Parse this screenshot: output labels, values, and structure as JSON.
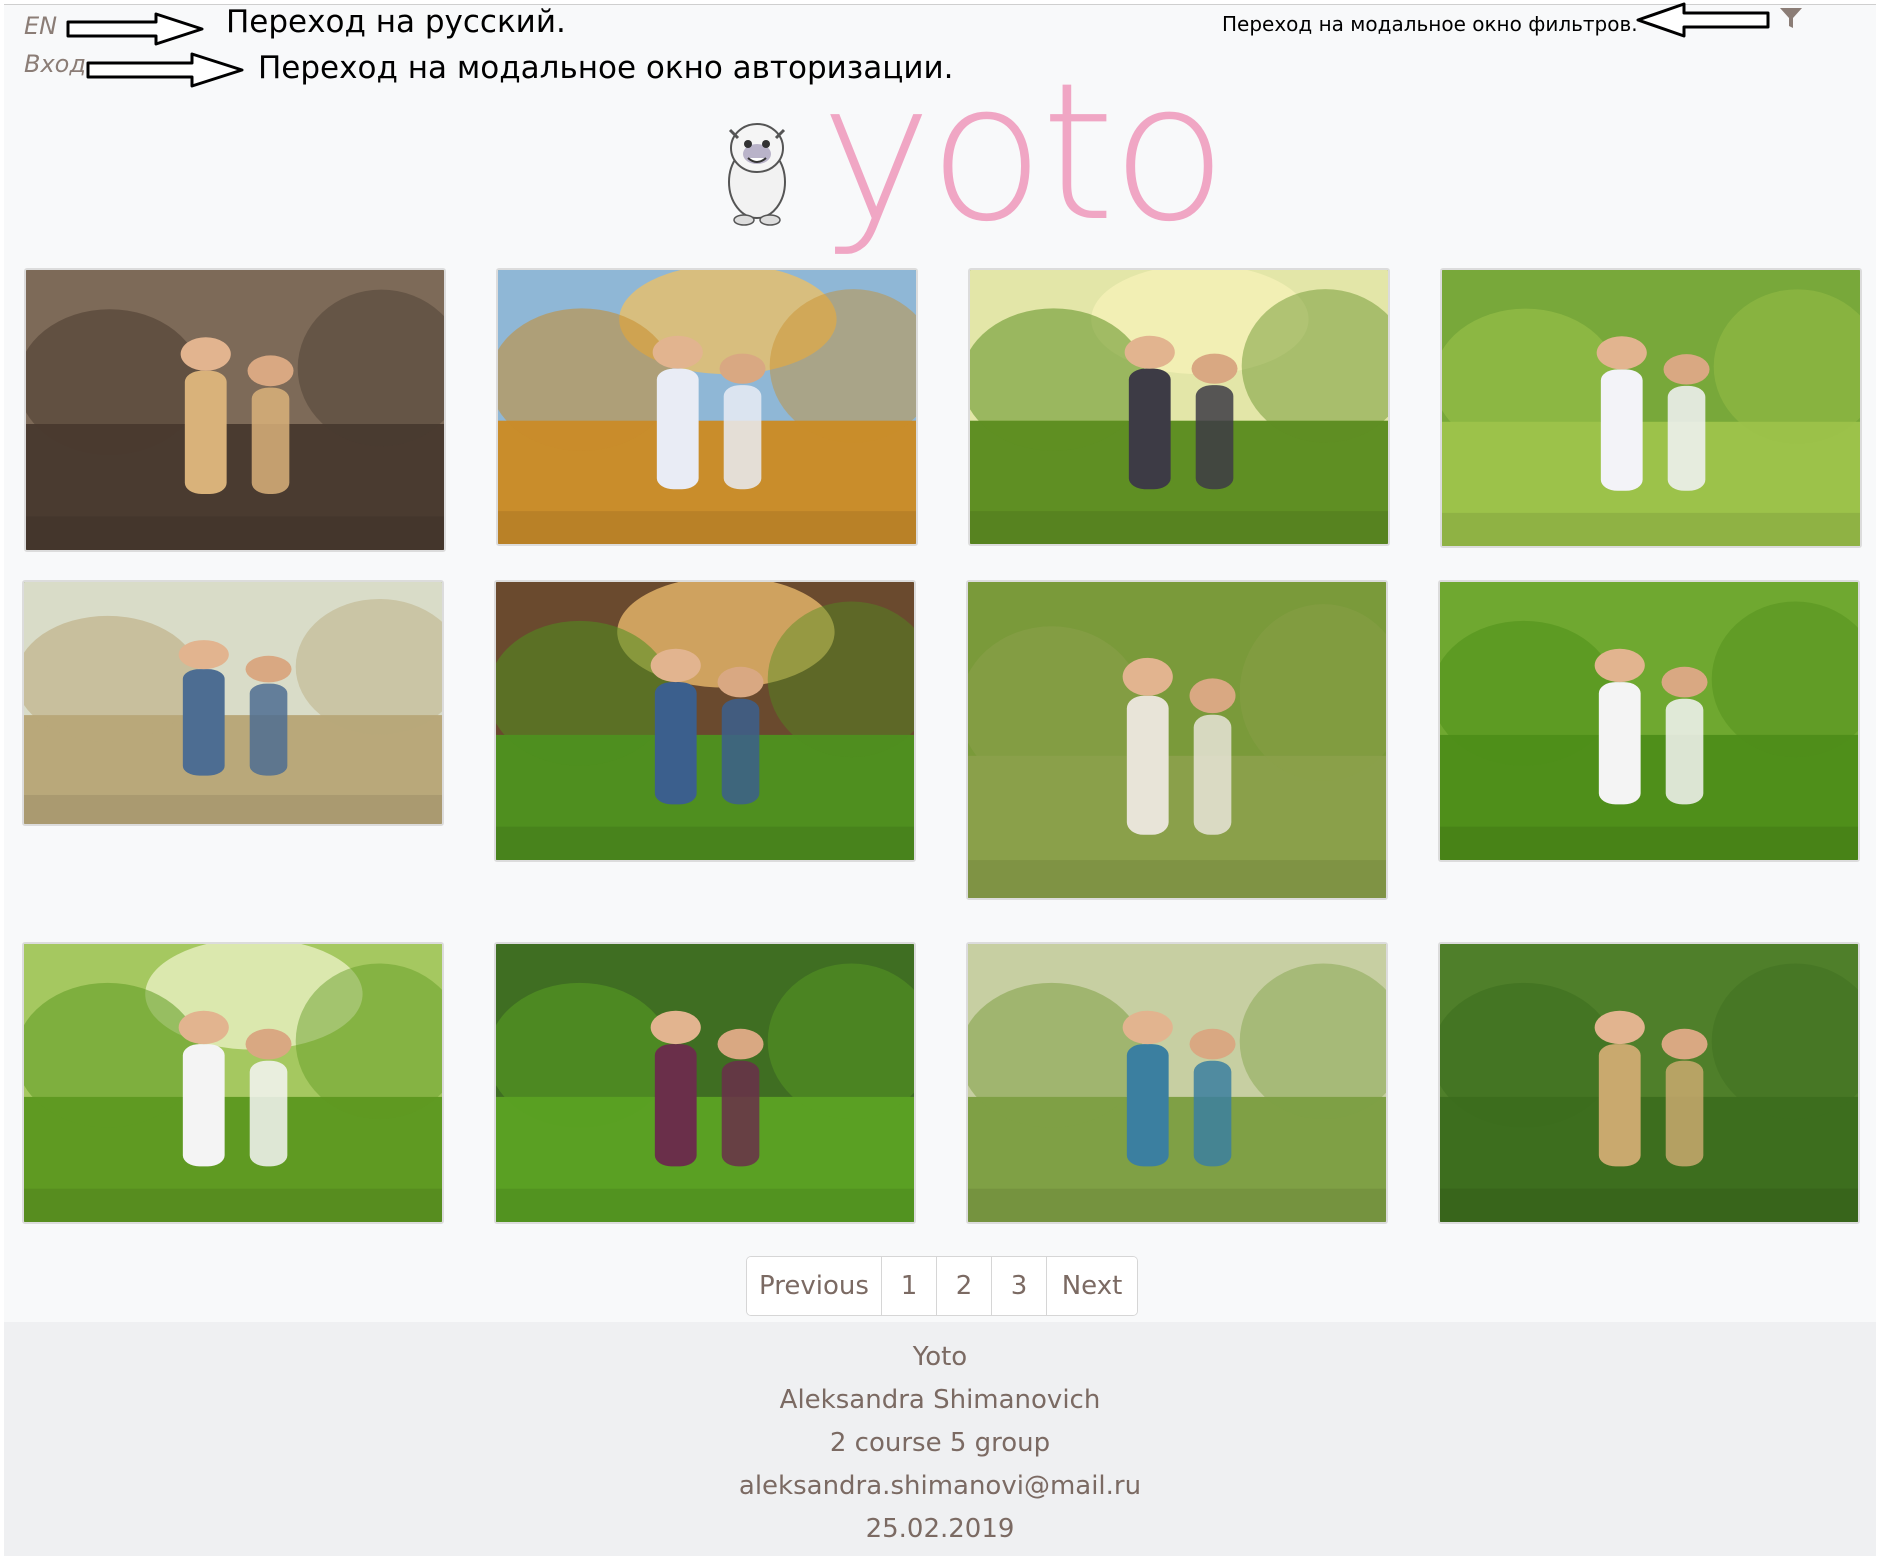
{
  "header": {
    "lang_link": "EN",
    "login_link": "Вход",
    "annotation_lang": "Переход на русский.",
    "annotation_login": "Переход на модальное окно авторизации.",
    "annotation_filter": "Переход на модальное окно фильтров.",
    "filter_icon": "filter-icon"
  },
  "logo": {
    "text": "yoto",
    "mascot_icon": "yeti-mascot-icon"
  },
  "gallery": {
    "photos": [
      {
        "description_icon": "portrait-woman-photo"
      },
      {
        "description_icon": "family-in-grass-photo"
      },
      {
        "description_icon": "family-walking-park-photo"
      },
      {
        "description_icon": "family-hug-photo"
      },
      {
        "description_icon": "parents-child-swing-photo"
      },
      {
        "description_icon": "photographers-forest-photo"
      },
      {
        "description_icon": "couple-baby-clothes-photo"
      },
      {
        "description_icon": "woman-flowers-field-photo"
      },
      {
        "description_icon": "family-picnic-photo"
      },
      {
        "description_icon": "mother-child-park-photo"
      },
      {
        "description_icon": "couple-dogs-balloons-photo"
      },
      {
        "description_icon": "woman-lupine-field-photo"
      }
    ]
  },
  "pagination": {
    "previous": "Previous",
    "pages": [
      "1",
      "2",
      "3"
    ],
    "next": "Next"
  },
  "footer": {
    "site_name": "Yoto",
    "author": "Aleksandra Shimanovich",
    "group": "2 course 5 group",
    "email": "aleksandra.shimanovi@mail.ru",
    "date": "25.02.2019"
  },
  "colors": {
    "text_muted": "#7b6a63",
    "logo_pink": "#f0a6c4",
    "page_bg": "#f8f9fa",
    "footer_bg": "#eff0f2"
  }
}
